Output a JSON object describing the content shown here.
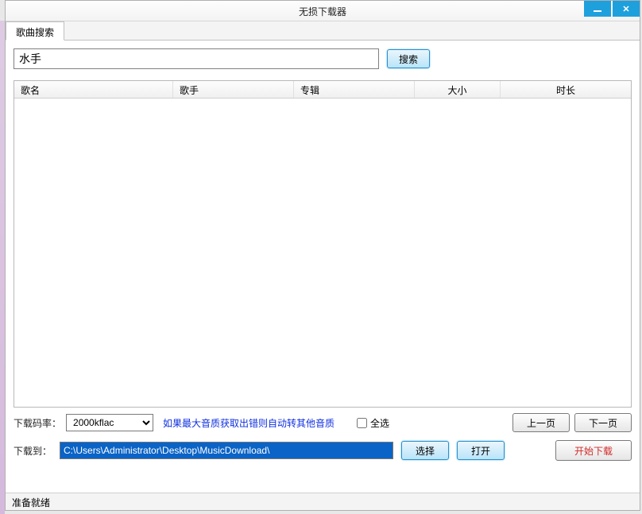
{
  "window": {
    "title": "无损下载器"
  },
  "tab": {
    "label": "歌曲搜索"
  },
  "search": {
    "value": "水手",
    "button": "搜索"
  },
  "columns": {
    "songname": "歌名",
    "singer": "歌手",
    "album": "专辑",
    "size": "大小",
    "duration": "时长"
  },
  "options": {
    "bitrate_label": "下载码率：",
    "bitrate_value": "2000kflac",
    "hint": "如果最大音质获取出错则自动转其他音质",
    "select_all": "全选",
    "prev_page": "上一页",
    "next_page": "下一页"
  },
  "download": {
    "label": "下载到：",
    "path": "C:\\Users\\Administrator\\Desktop\\MusicDownload\\",
    "choose": "选择",
    "open": "打开",
    "start": "开始下载"
  },
  "status": {
    "text": "准备就绪"
  }
}
